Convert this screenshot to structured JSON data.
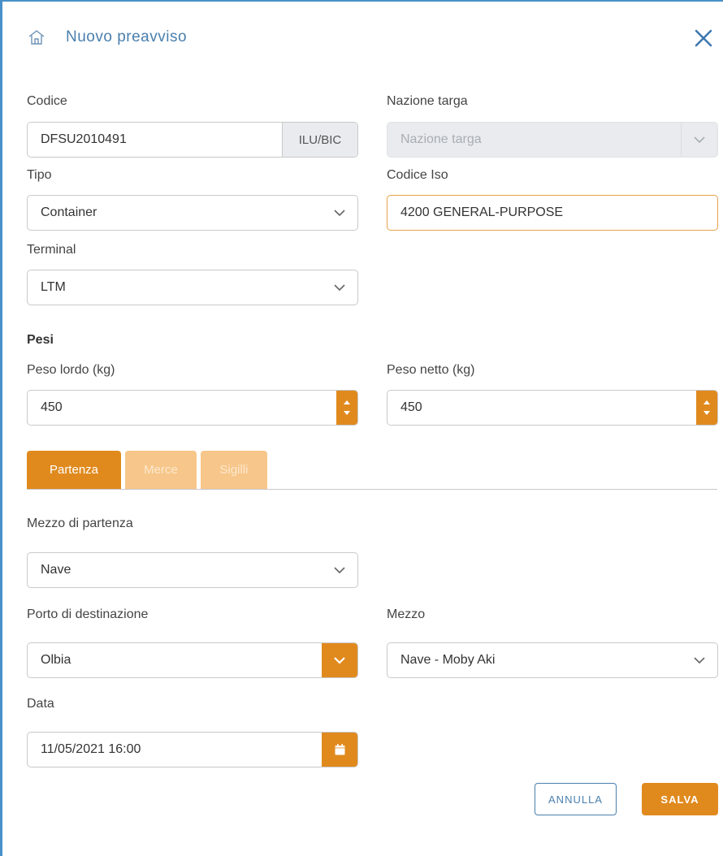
{
  "header": {
    "title": "Nuovo preavviso",
    "icon": "house-icon",
    "close_icon": "close-icon"
  },
  "form": {
    "codice": {
      "label": "Codice",
      "value": "DFSU2010491",
      "addon": "ILU/BIC"
    },
    "nazione_targa": {
      "label": "Nazione targa",
      "placeholder": "Nazione targa"
    },
    "tipo": {
      "label": "Tipo",
      "value": "Container"
    },
    "codice_iso": {
      "label": "Codice Iso",
      "value": "4200 GENERAL-PURPOSE"
    },
    "terminal": {
      "label": "Terminal",
      "value": "LTM"
    },
    "pesi": {
      "section_title": "Pesi",
      "peso_lordo": {
        "label": "Peso lordo (kg)",
        "value": "450"
      },
      "peso_netto": {
        "label": "Peso netto (kg)",
        "value": "450"
      }
    }
  },
  "tabs": [
    {
      "label": "Partenza",
      "active": true
    },
    {
      "label": "Merce",
      "active": false
    },
    {
      "label": "Sigilli",
      "active": false
    }
  ],
  "partenza": {
    "mezzo_di_partenza": {
      "label": "Mezzo di partenza",
      "value": "Nave"
    },
    "porto_di_destinazione": {
      "label": "Porto di destinazione",
      "value": "Olbia"
    },
    "mezzo": {
      "label": "Mezzo",
      "value": "Nave - Moby Aki"
    },
    "data": {
      "label": "Data",
      "value": "11/05/2021 16:00"
    }
  },
  "actions": {
    "cancel_label": "ANNULLA",
    "save_label": "SALVA"
  },
  "colors": {
    "accent": "#e08a1e",
    "accent_light": "#f7c68a",
    "title_blue": "#4a7fad",
    "frame_blue": "#4a90c8"
  }
}
